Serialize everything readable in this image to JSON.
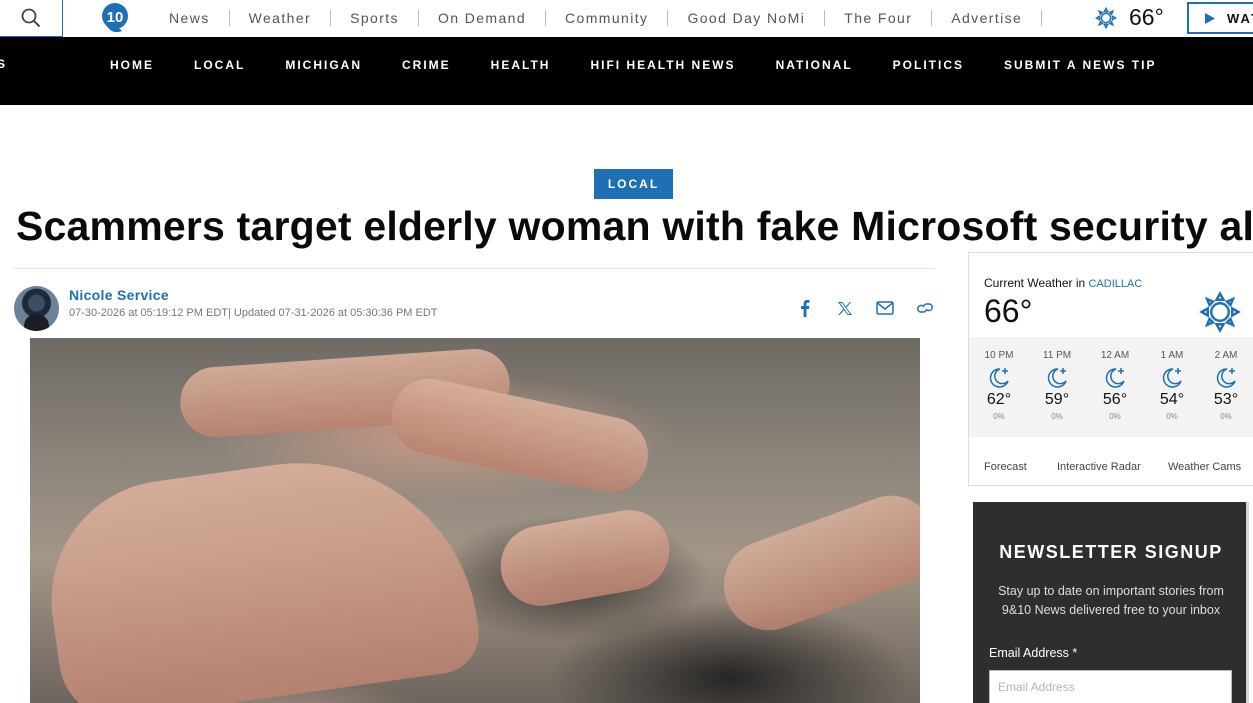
{
  "topbar": {
    "logo_text": "10",
    "nav": [
      "News",
      "Weather",
      "Sports",
      "On Demand",
      "Community",
      "Good Day NoMi",
      "The Four",
      "Advertise"
    ],
    "temperature": "66°",
    "watch_label": "WAT"
  },
  "mainnav": {
    "edge_label": "S",
    "links": [
      "HOME",
      "LOCAL",
      "MICHIGAN",
      "CRIME",
      "HEALTH",
      "HIFI HEALTH NEWS",
      "NATIONAL",
      "POLITICS",
      "SUBMIT A NEWS TIP"
    ]
  },
  "article": {
    "category": "LOCAL",
    "headline": "Scammers target elderly woman with fake Microsoft security alert",
    "author": "Nicole Service",
    "dates": "07-30-2026 at 05:19:12 PM EDT| Updated 07-31-2026 at 05:30:36 PM EDT"
  },
  "share_icons": [
    "facebook-icon",
    "x-icon",
    "email-icon",
    "link-icon"
  ],
  "weather": {
    "label": "Current Weather in",
    "city": "CADILLAC",
    "temp": "66°",
    "icon": "sun-icon",
    "hours": [
      {
        "time": "10 PM",
        "temp": "62°",
        "precip": "0%"
      },
      {
        "time": "11 PM",
        "temp": "59°",
        "precip": "0%"
      },
      {
        "time": "12 AM",
        "temp": "56°",
        "precip": "0%"
      },
      {
        "time": "1 AM",
        "temp": "54°",
        "precip": "0%"
      },
      {
        "time": "2 AM",
        "temp": "53°",
        "precip": "0%"
      }
    ],
    "links": [
      "Forecast",
      "Interactive Radar",
      "Weather Cams"
    ]
  },
  "newsletter": {
    "title": "NEWSLETTER SIGNUP",
    "subtitle": "Stay up to date on important stories from 9&10 News delivered free to your inbox",
    "email_label": "Email Address *",
    "email_placeholder": "Email Address"
  },
  "colors": {
    "accent": "#1f6fb5",
    "nav_bg": "#000000",
    "newsletter_bg": "#2e2e2e"
  }
}
